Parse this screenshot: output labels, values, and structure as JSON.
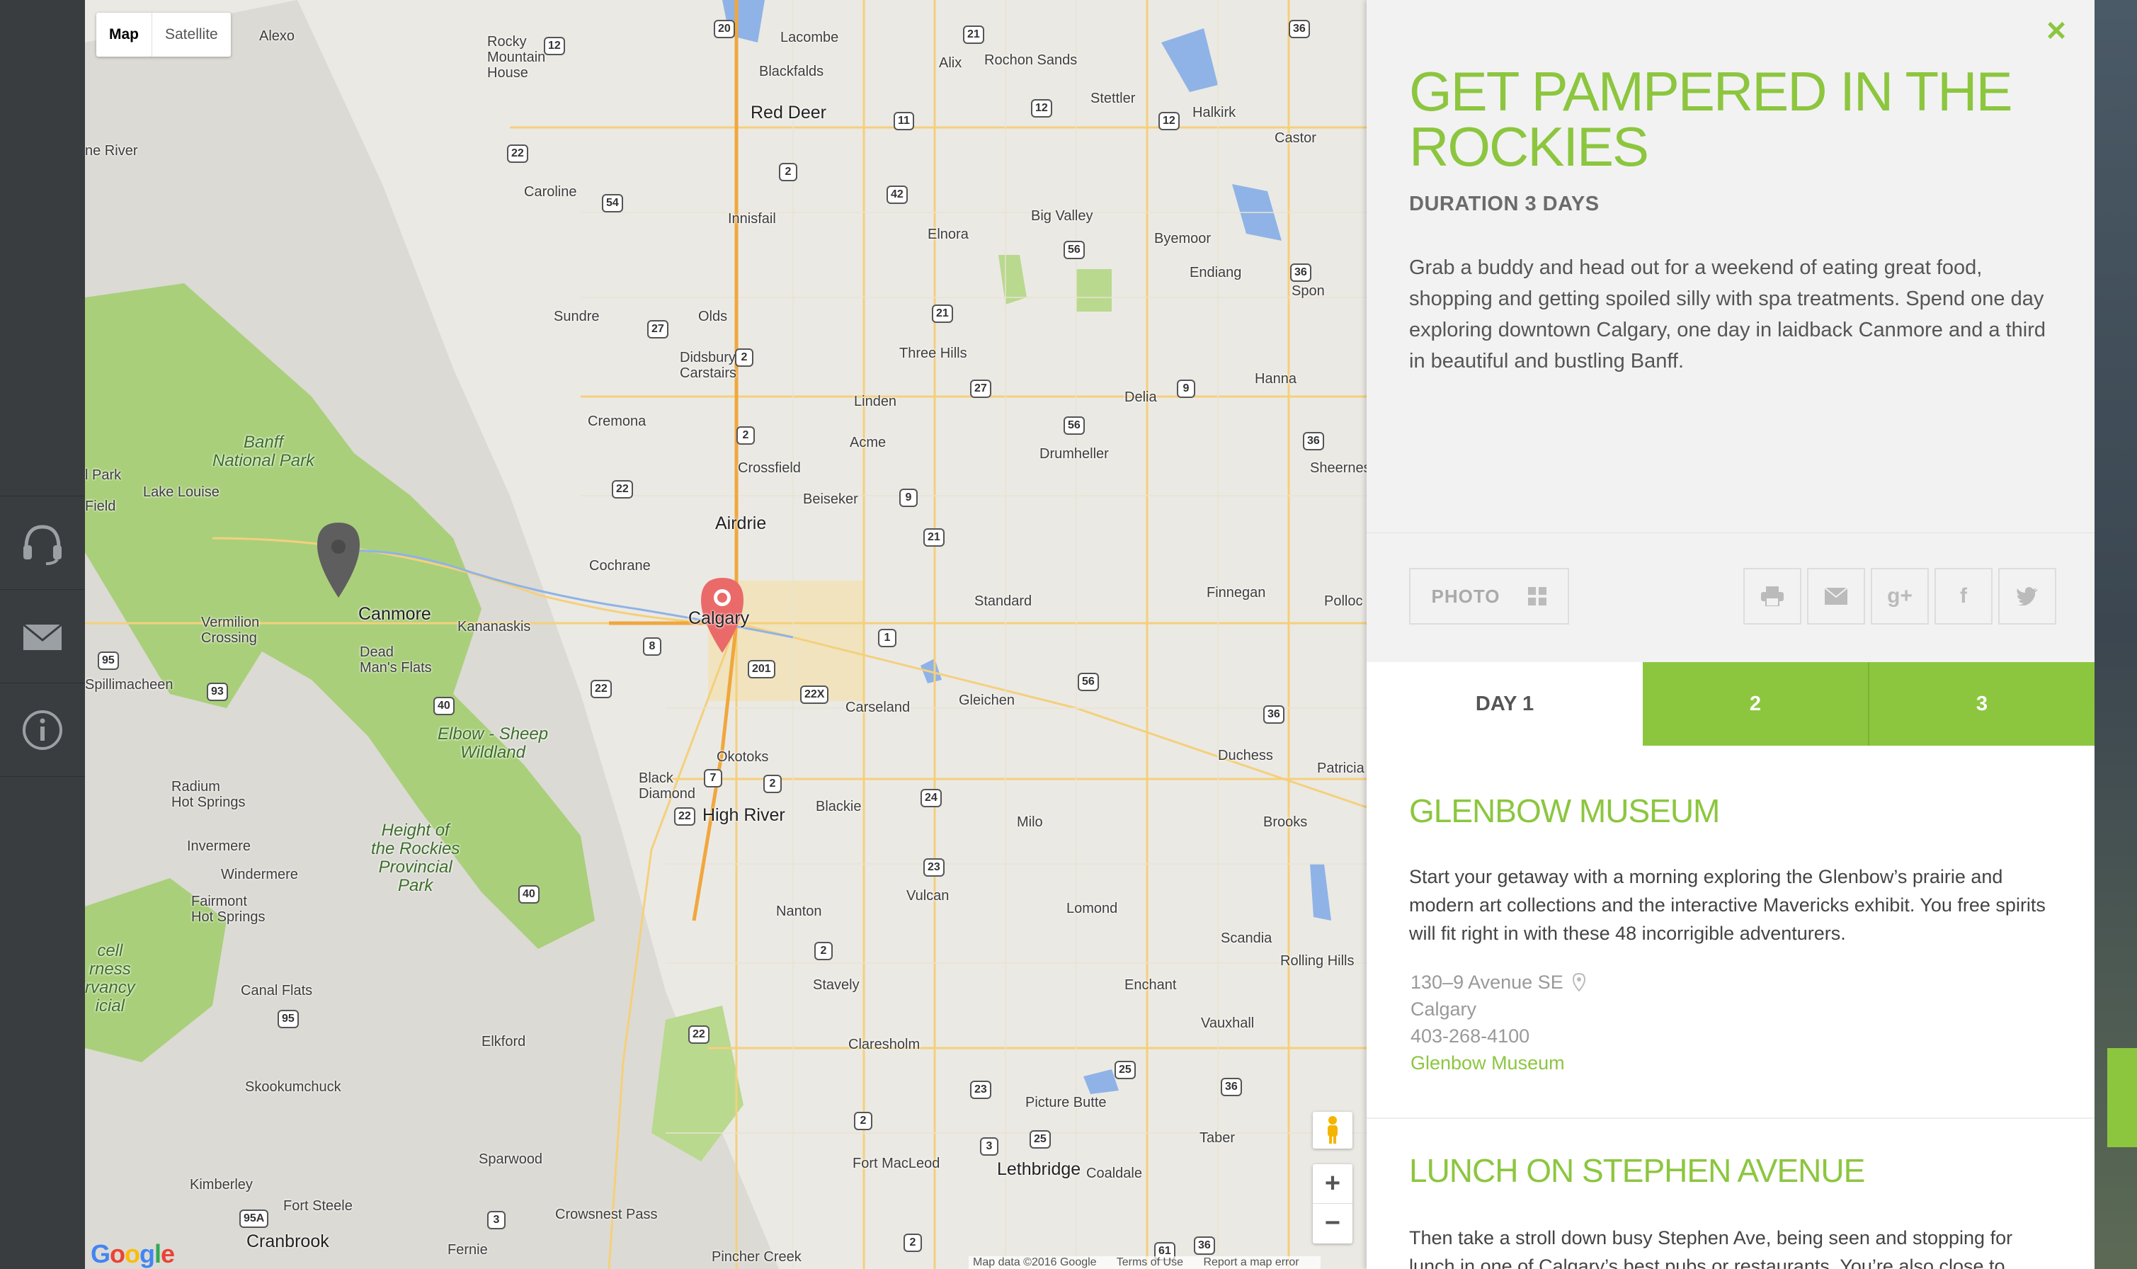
{
  "map": {
    "type_buttons": [
      "Map",
      "Satellite"
    ],
    "places": [
      {
        "t": "Alexo",
        "c": ""
      },
      {
        "t": "Rocky\nMountain\nHouse",
        "c": ""
      },
      {
        "t": "Lacombe",
        "c": ""
      },
      {
        "t": "Blackfalds",
        "c": ""
      },
      {
        "t": "Alix",
        "c": ""
      },
      {
        "t": "Rochon Sands",
        "c": ""
      },
      {
        "t": "Red Deer",
        "c": "city"
      },
      {
        "t": "Stettler",
        "c": ""
      },
      {
        "t": "Halkirk",
        "c": ""
      },
      {
        "t": "Castor",
        "c": ""
      },
      {
        "t": "ne River",
        "c": ""
      },
      {
        "t": "Caroline",
        "c": ""
      },
      {
        "t": "Innisfail",
        "c": ""
      },
      {
        "t": "Big Valley",
        "c": ""
      },
      {
        "t": "Elnora",
        "c": ""
      },
      {
        "t": "Byemoor",
        "c": ""
      },
      {
        "t": "Endiang",
        "c": ""
      },
      {
        "t": "Spon",
        "c": ""
      },
      {
        "t": "Sundre",
        "c": ""
      },
      {
        "t": "Olds",
        "c": ""
      },
      {
        "t": "Three Hills",
        "c": ""
      },
      {
        "t": "Hanna",
        "c": ""
      },
      {
        "t": "Didsbury\nCarstairs",
        "c": ""
      },
      {
        "t": "Linden",
        "c": ""
      },
      {
        "t": "Delia",
        "c": ""
      },
      {
        "t": "Cremona",
        "c": ""
      },
      {
        "t": "Acme",
        "c": ""
      },
      {
        "t": "Drumheller",
        "c": ""
      },
      {
        "t": "Sheerness",
        "c": ""
      },
      {
        "t": "Crossfield",
        "c": ""
      },
      {
        "t": "l Park",
        "c": ""
      },
      {
        "t": "Lake Louise",
        "c": ""
      },
      {
        "t": "Field",
        "c": ""
      },
      {
        "t": "Beiseker",
        "c": ""
      },
      {
        "t": "Airdrie",
        "c": "city"
      },
      {
        "t": "Cochrane",
        "c": ""
      },
      {
        "t": "Standard",
        "c": ""
      },
      {
        "t": "Finnegan",
        "c": ""
      },
      {
        "t": "Polloc",
        "c": ""
      },
      {
        "t": "Canmore",
        "c": "city"
      },
      {
        "t": "Kananaskis",
        "c": ""
      },
      {
        "t": "Calgary",
        "c": "city"
      },
      {
        "t": "Vermilion\nCrossing",
        "c": ""
      },
      {
        "t": "Dead\nMan's Flats",
        "c": ""
      },
      {
        "t": "Spillimacheen",
        "c": ""
      },
      {
        "t": "Carseland",
        "c": ""
      },
      {
        "t": "Gleichen",
        "c": ""
      },
      {
        "t": "Okotoks",
        "c": ""
      },
      {
        "t": "Duchess",
        "c": ""
      },
      {
        "t": "Patricia",
        "c": ""
      },
      {
        "t": "Black\nDiamond",
        "c": ""
      },
      {
        "t": "Radium\nHot Springs",
        "c": ""
      },
      {
        "t": "High River",
        "c": "city"
      },
      {
        "t": "Blackie",
        "c": ""
      },
      {
        "t": "Milo",
        "c": ""
      },
      {
        "t": "Brooks",
        "c": ""
      },
      {
        "t": "Invermere",
        "c": ""
      },
      {
        "t": "Windermere",
        "c": ""
      },
      {
        "t": "Fairmont\nHot Springs",
        "c": ""
      },
      {
        "t": "Vulcan",
        "c": ""
      },
      {
        "t": "Lomond",
        "c": ""
      },
      {
        "t": "Nanton",
        "c": ""
      },
      {
        "t": "Scandia",
        "c": ""
      },
      {
        "t": "cell\nrness\nrvancy\nicial",
        "c": "park"
      },
      {
        "t": "Rolling Hills",
        "c": ""
      },
      {
        "t": "Stavely",
        "c": ""
      },
      {
        "t": "Canal Flats",
        "c": ""
      },
      {
        "t": "Enchant",
        "c": ""
      },
      {
        "t": "Vauxhall",
        "c": ""
      },
      {
        "t": "Elkford",
        "c": ""
      },
      {
        "t": "Claresholm",
        "c": ""
      },
      {
        "t": "Skookumchuck",
        "c": ""
      },
      {
        "t": "Picture Butte",
        "c": ""
      },
      {
        "t": "Taber",
        "c": ""
      },
      {
        "t": "Sparwood",
        "c": ""
      },
      {
        "t": "Fort MacLeod",
        "c": ""
      },
      {
        "t": "Lethbridge",
        "c": "city"
      },
      {
        "t": "Coaldale",
        "c": ""
      },
      {
        "t": "Kimberley",
        "c": ""
      },
      {
        "t": "Fort Steele",
        "c": ""
      },
      {
        "t": "Crowsnest Pass",
        "c": ""
      },
      {
        "t": "Cranbrook",
        "c": "city"
      },
      {
        "t": "Fernie",
        "c": ""
      },
      {
        "t": "Pincher Creek",
        "c": ""
      },
      {
        "t": "Banff\nNational Park",
        "c": "park"
      },
      {
        "t": "Elbow - Sheep\nWildland",
        "c": "park"
      },
      {
        "t": "Height of\nthe Rockies\nProvincial\nPark",
        "c": "park"
      }
    ],
    "shields": [
      "20",
      "21",
      "36",
      "12",
      "11",
      "12",
      "12",
      "22",
      "54",
      "2",
      "42",
      "56",
      "36",
      "27",
      "21",
      "27",
      "9",
      "2",
      "56",
      "36",
      "2",
      "22",
      "9",
      "21",
      "1",
      "8",
      "201",
      "22X",
      "22",
      "56",
      "36",
      "7",
      "2",
      "24",
      "22",
      "23",
      "95",
      "93",
      "40",
      "40",
      "2",
      "22",
      "95",
      "23",
      "25",
      "36",
      "2",
      "3",
      "25",
      "3",
      "95A",
      "2",
      "61",
      "36"
    ],
    "pegman_icon": "pegman-icon",
    "zoom_in": "+",
    "zoom_out": "−",
    "google_logo": "Google",
    "attribution": [
      "Map data ©2016 Google",
      "Terms of Use",
      "Report a map error"
    ]
  },
  "rail": {
    "items": [
      {
        "icon": "headset-icon"
      },
      {
        "icon": "envelope-icon"
      },
      {
        "icon": "info-icon"
      }
    ]
  },
  "panel": {
    "close_icon": "×",
    "title": "GET PAMPERED IN THE ROCKIES",
    "duration": "DURATION 3 DAYS",
    "description": "Grab a buddy and head out for a weekend of eating great food, shopping and getting spoiled silly with spa treatments. Spend one day exploring downtown Calgary, one day in laidback Canmore and a third in beautiful and bustling Banff.",
    "photo_button": "PHOTO",
    "share_icons": [
      "print-icon",
      "email-icon",
      "google-plus-icon",
      "facebook-icon",
      "twitter-icon"
    ],
    "tabs": [
      "DAY 1",
      "2",
      "3"
    ],
    "stops": [
      {
        "title": "GLENBOW MUSEUM",
        "text": "Start your getaway with a morning exploring the Glenbow’s prairie and modern art collections and the interactive Mavericks exhibit. You free spirits will fit right in with these 48 incorrigible adventurers.",
        "address": "130–9 Avenue SE",
        "city": "Calgary",
        "phone": "403-268-4100",
        "link": "Glenbow Museum"
      },
      {
        "title": "LUNCH ON STEPHEN AVENUE",
        "text": "Then take a stroll down busy Stephen Ave, being seen and stopping for lunch in one of Calgary’s best pubs or restaurants. You’re also close to"
      }
    ],
    "colors": {
      "accent": "#8cc63f",
      "rail": "#3a3d40"
    }
  }
}
